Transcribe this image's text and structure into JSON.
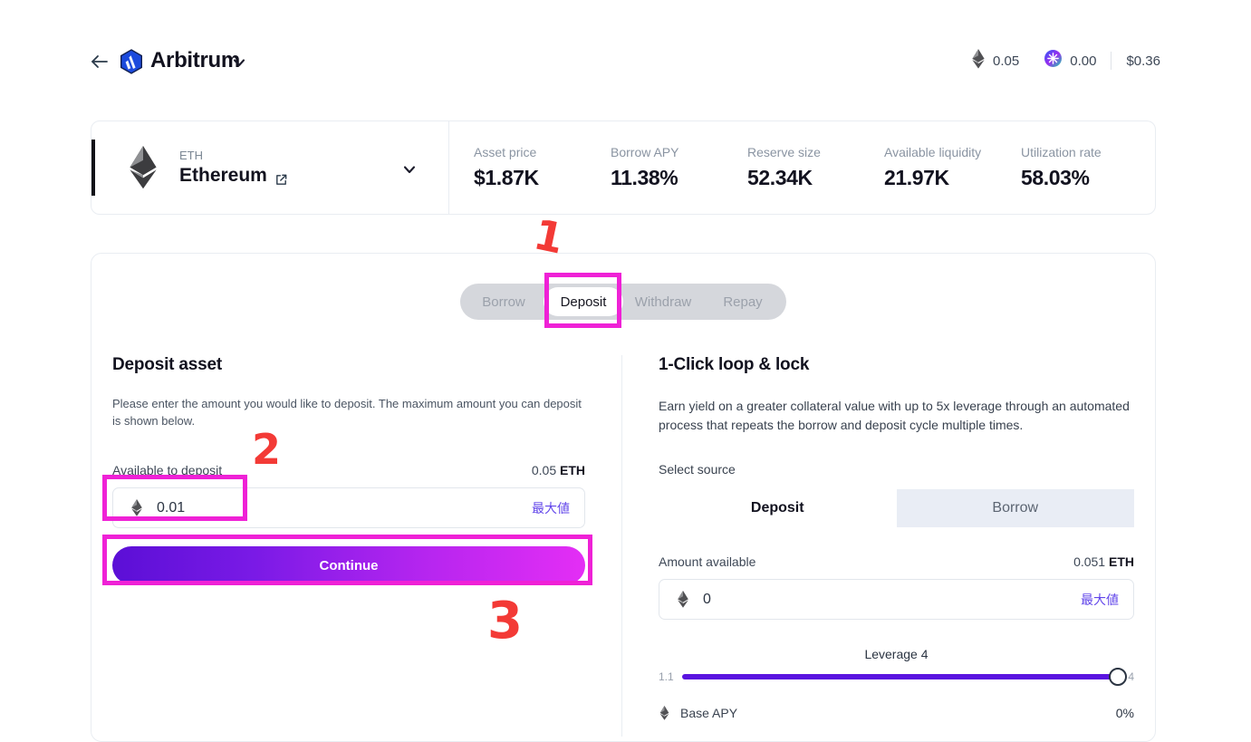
{
  "header": {
    "back_icon": "arrow-left-icon",
    "chain_logo_icon": "arbitrum-logo-icon",
    "chain_name": "Arbitrum",
    "chain_caret_icon": "chevron-down-icon",
    "wallet": {
      "eth_icon": "ethereum-icon",
      "eth_balance": "0.05",
      "token_icon": "star-token-icon",
      "token_balance": "0.00",
      "usd_value": "$0.36"
    }
  },
  "asset": {
    "logo_icon": "ethereum-icon",
    "symbol": "ETH",
    "name": "Ethereum",
    "external_link_icon": "external-link-icon",
    "caret_icon": "chevron-down-icon",
    "stats": [
      {
        "label": "Asset price",
        "value": "$1.87K"
      },
      {
        "label": "Borrow APY",
        "value": "11.38%"
      },
      {
        "label": "Reserve size",
        "value": "52.34K"
      },
      {
        "label": "Available liquidity",
        "value": "21.97K"
      },
      {
        "label": "Utilization rate",
        "value": "58.03%"
      }
    ]
  },
  "tabs": [
    {
      "label": "Borrow",
      "active": false
    },
    {
      "label": "Deposit",
      "active": true
    },
    {
      "label": "Withdraw",
      "active": false
    },
    {
      "label": "Repay",
      "active": false
    }
  ],
  "deposit_panel": {
    "title": "Deposit asset",
    "description": "Please enter the amount you would like to deposit. The maximum amount you can deposit is shown below.",
    "available_label": "Available to deposit",
    "available_amount": "0.05",
    "available_symbol": "ETH",
    "input_icon": "ethereum-icon",
    "input_value": "0.01",
    "input_placeholder": "0",
    "max_label": "最大値",
    "continue_label": "Continue"
  },
  "loop_panel": {
    "title": "1-Click loop & lock",
    "description": "Earn yield on a greater collateral value with up to 5x leverage through an automated process that repeats the borrow and deposit cycle multiple times.",
    "select_source_label": "Select source",
    "sources": [
      {
        "label": "Deposit",
        "active": true
      },
      {
        "label": "Borrow",
        "active": false
      }
    ],
    "amount_label": "Amount available",
    "amount_available": "0.051",
    "amount_symbol": "ETH",
    "input_icon": "ethereum-icon",
    "input_value": "0",
    "input_placeholder": "0",
    "max_label": "最大値",
    "leverage_label": "Leverage",
    "leverage_value": "4",
    "leverage_min": "1.1",
    "leverage_max": "4",
    "base_apy_icon": "ethereum-icon",
    "base_apy_label": "Base APY",
    "base_apy_value": "0%"
  },
  "annotations": {
    "mark_1": "1",
    "mark_2": "2",
    "mark_3": "3",
    "highlight_color": "#ef21d6",
    "mark_color": "#f33a36"
  }
}
